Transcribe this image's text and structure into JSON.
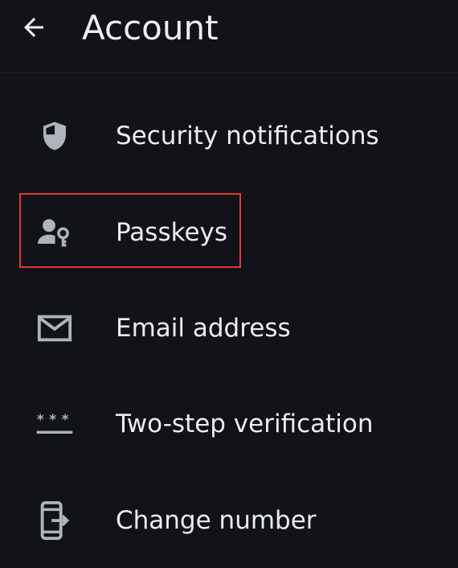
{
  "header": {
    "title": "Account",
    "back_icon": "arrow-left-icon"
  },
  "items": [
    {
      "label": "Security notifications",
      "icon": "shield-icon"
    },
    {
      "label": "Passkeys",
      "icon": "person-key-icon"
    },
    {
      "label": "Email address",
      "icon": "mail-icon"
    },
    {
      "label": "Two-step verification",
      "icon": "password-dots-icon"
    },
    {
      "label": "Change number",
      "icon": "phone-transfer-icon"
    }
  ],
  "colors": {
    "background": "#111318",
    "text": "#e9edef",
    "icon": "#aeb4b9",
    "highlight": "#e53935"
  }
}
